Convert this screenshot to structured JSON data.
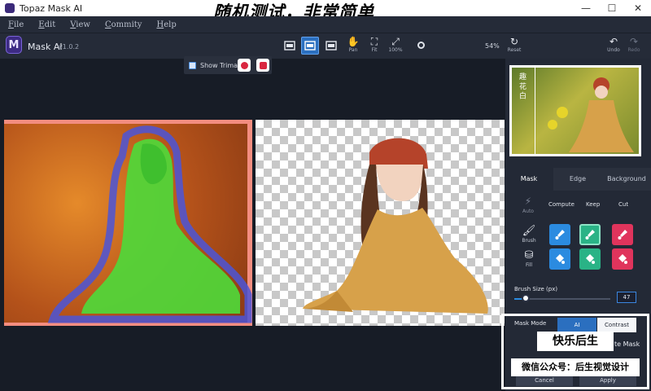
{
  "window": {
    "title": "Topaz Mask AI",
    "overlay_text": "随机测试，非常简单",
    "minimize": "—",
    "maximize": "☐",
    "close": "✕"
  },
  "menu": [
    "File",
    "Edit",
    "View",
    "Commity",
    "Help"
  ],
  "toolbar": {
    "logo_letter": "M",
    "app_name": "Mask AI",
    "version": "v1.0.2",
    "tools": {
      "pan": "Pan",
      "fit": "Fit",
      "zoom100": "100%",
      "reset": "Reset",
      "undo": "Undo",
      "redo": "Redo"
    },
    "zoom_value": "54%"
  },
  "trimap": {
    "label": "Show Trimap"
  },
  "panel": {
    "tabs": [
      "Mask",
      "Edge",
      "Background"
    ],
    "modes": {
      "auto": "Auto",
      "compute": "Compute",
      "keep": "Keep",
      "cut": "Cut"
    },
    "tools": {
      "brush": "Brush",
      "fill": "Fill"
    },
    "brush_size_label": "Brush Size (px)",
    "brush_size_value": "47",
    "brush_size_fraction": 0.12,
    "mask_mode_label": "Mask Mode",
    "mask_mode_ai": "AI",
    "mask_mode_contrast": "Contrast",
    "mask_trail": "te Mask",
    "cancel": "Cancel",
    "apply": "Apply",
    "preview_text": "趣 花 白"
  },
  "watermark": {
    "line1": "快乐后生",
    "line2": "微信公众号：后生视觉设计"
  },
  "colors": {
    "accent_blue": "#2b8be0",
    "keep_green": "#2ab386",
    "cut_red": "#e0345c"
  }
}
